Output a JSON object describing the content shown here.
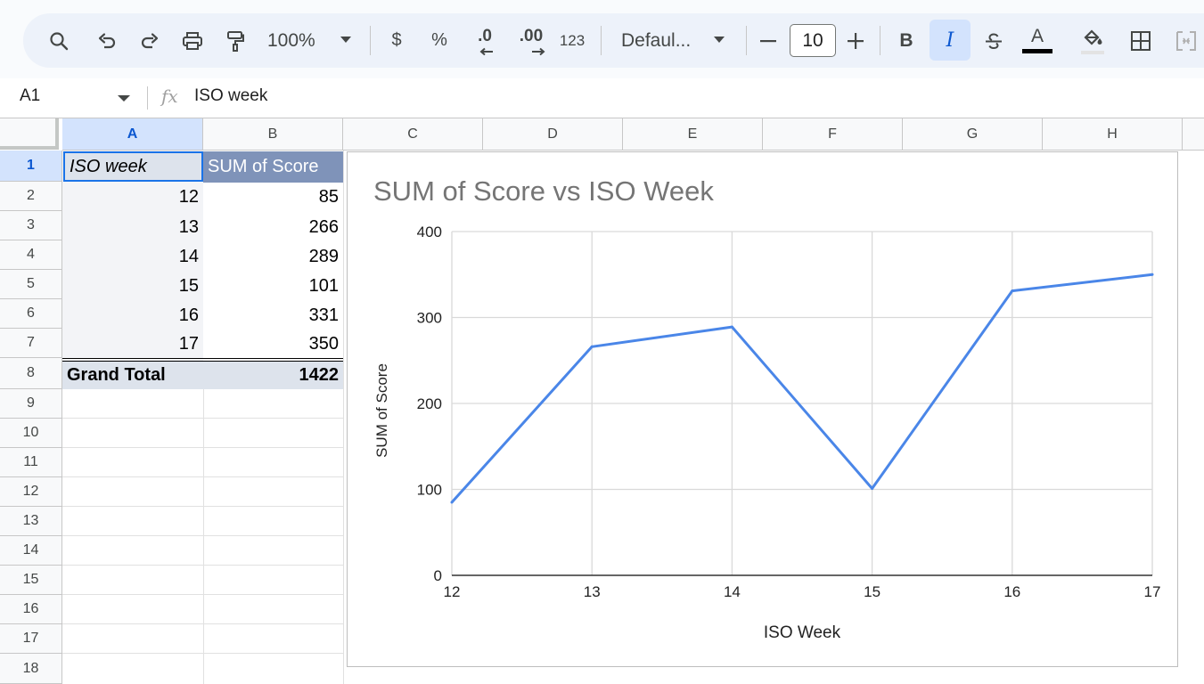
{
  "toolbar": {
    "zoom": "100%",
    "currency": "$",
    "percent": "%",
    "decrease_decimal": ".0",
    "increase_decimal": ".00",
    "more_formats": "123",
    "font": "Defaul...",
    "font_size": "10",
    "bold": "B",
    "italic": "I",
    "text_color_label": "A",
    "text_color": "#000000",
    "italic_active": true
  },
  "formula_bar": {
    "cell_ref": "A1",
    "formula": "ISO week"
  },
  "columns": [
    "A",
    "B",
    "C",
    "D",
    "E",
    "F",
    "G",
    "H"
  ],
  "rows": [
    "1",
    "2",
    "3",
    "4",
    "5",
    "6",
    "7",
    "8",
    "9",
    "10",
    "11",
    "12",
    "13",
    "14",
    "15",
    "16",
    "17",
    "18"
  ],
  "pivot": {
    "header_a": "ISO week",
    "header_b": "SUM of Score",
    "rows": [
      {
        "week": "12",
        "score": "85"
      },
      {
        "week": "13",
        "score": "266"
      },
      {
        "week": "14",
        "score": "289"
      },
      {
        "week": "15",
        "score": "101"
      },
      {
        "week": "16",
        "score": "331"
      },
      {
        "week": "17",
        "score": "350"
      }
    ],
    "total_label": "Grand Total",
    "total_value": "1422"
  },
  "colors": {
    "accent": "#1a73e8",
    "pivot_header": "#7f93b9",
    "line": "#4a86e8"
  },
  "chart_data": {
    "type": "line",
    "title": "SUM of Score vs ISO Week",
    "xlabel": "ISO Week",
    "ylabel": "SUM of Score",
    "categories": [
      "12",
      "13",
      "14",
      "15",
      "16",
      "17"
    ],
    "values": [
      85,
      266,
      289,
      101,
      331,
      350
    ],
    "ylim": [
      0,
      400
    ],
    "yticks": [
      "0",
      "100",
      "200",
      "300",
      "400"
    ],
    "grid": true,
    "legend": "none"
  }
}
